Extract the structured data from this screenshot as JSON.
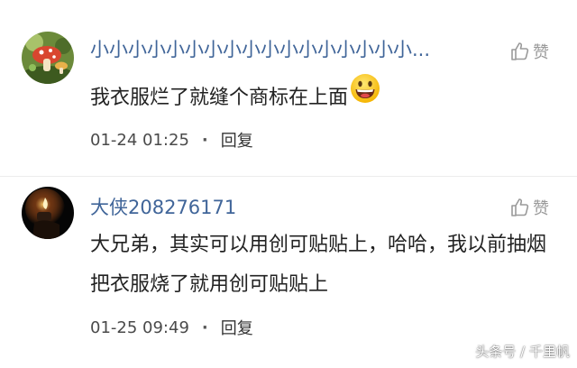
{
  "comments": [
    {
      "username": "小小小小小小小小小小小小小小小小小...",
      "text": "我衣服烂了就缝个商标在上面",
      "emoji": "grinning-face",
      "date": "01-24 01:25",
      "separator": "·",
      "reply_label": "回复",
      "like_label": "赞"
    },
    {
      "username": "大侠208276171",
      "text": "大兄弟，其实可以用创可贴贴上，哈哈，我以前抽烟把衣服烧了就用创可贴贴上",
      "date": "01-25 09:49",
      "separator": "·",
      "reply_label": "回复",
      "like_label": "赞"
    }
  ],
  "watermark": "头条号 / 千里帆",
  "colors": {
    "username": "#406599",
    "text": "#222222",
    "meta": "#4a4a4a",
    "like": "#9a9a9a"
  }
}
